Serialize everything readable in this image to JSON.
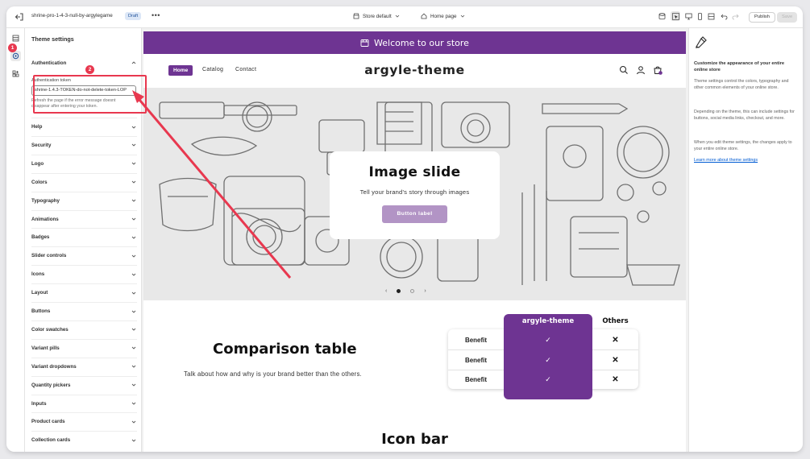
{
  "topbar": {
    "theme_name": "shrine-pro-1-4-3-null-by-argylegame",
    "status_badge": "Draft",
    "more": "•••",
    "store_select": "Store default",
    "page_select": "Home page",
    "publish_label": "Publish",
    "save_label": "Save"
  },
  "settings": {
    "title": "Theme settings",
    "expanded_section": "Authentication",
    "auth_label": "Authentication token",
    "auth_value": "shrine-1.4.3-TOKEN-do-not-delete-token-LOP",
    "auth_help": "Refresh the page if the error message doesnt disappear after entering your token.",
    "sections": [
      "Help",
      "Security",
      "Logo",
      "Colors",
      "Typography",
      "Animations",
      "Badges",
      "Slider controls",
      "Icons",
      "Layout",
      "Buttons",
      "Color swatches",
      "Variant pills",
      "Variant dropdowns",
      "Quantity pickers",
      "Inputs",
      "Product cards",
      "Collection cards"
    ]
  },
  "annotations": {
    "badge_1": "1",
    "badge_2": "2",
    "color": "#e8384f"
  },
  "preview": {
    "announcement": "Welcome to our store",
    "nav": {
      "home": "Home",
      "catalog": "Catalog",
      "contact": "Contact"
    },
    "logo": "argyle-theme",
    "accent": "#6e3492",
    "slide": {
      "title": "Image slide",
      "subtitle": "Tell your brand's story through images",
      "button": "Button label"
    },
    "comparison": {
      "title": "Comparison table",
      "subtitle": "Talk about how and why is your brand better than the others.",
      "col_brand": "argyle-theme",
      "col_other": "Others",
      "rows": [
        "Benefit",
        "Benefit",
        "Benefit"
      ],
      "check": "✓",
      "cross": "✕"
    },
    "icon_bar_title": "Icon bar"
  },
  "help": {
    "heading": "Customize the appearance of your entire online store",
    "p1": "Theme settings control the colors, typography and other common elements of your online store.",
    "p2": "Depending on the theme, this can include settings for buttons, social media links, checkout, and more.",
    "p3": "When you edit theme settings, the changes apply to your entire online store.",
    "link": "Learn more about theme settings"
  }
}
